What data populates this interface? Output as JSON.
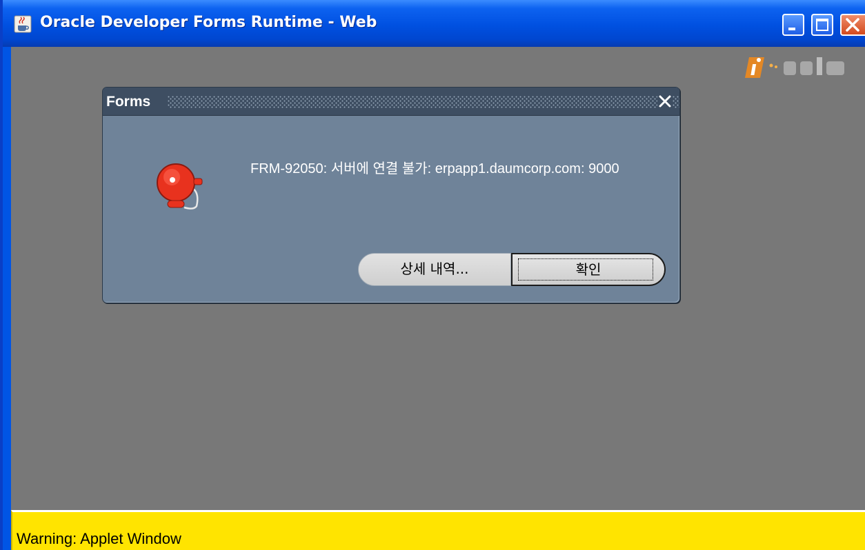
{
  "window": {
    "title": "Oracle Developer Forms Runtime - Web"
  },
  "dialog": {
    "title": "Forms",
    "message": "FRM-92050: 서버에 연결 불가: erpapp1.daumcorp.com: 9000",
    "buttons": {
      "details_label": "상세 내역...",
      "ok_label": "확인"
    }
  },
  "status_bar": {
    "text": "Warning: Applet Window"
  },
  "icons": {
    "app": "java-coffee-icon",
    "alert": "alarm-bell-icon",
    "close": "close-icon",
    "minimize": "minimize-icon",
    "maximize": "maximize-icon"
  },
  "colors": {
    "titlebar": "#0050e0",
    "desktop": "#787878",
    "dialog_body": "#6f8399",
    "dialog_titlebar": "#3e4e62",
    "alert_red": "#e8321e",
    "status_bar": "#ffe400"
  }
}
